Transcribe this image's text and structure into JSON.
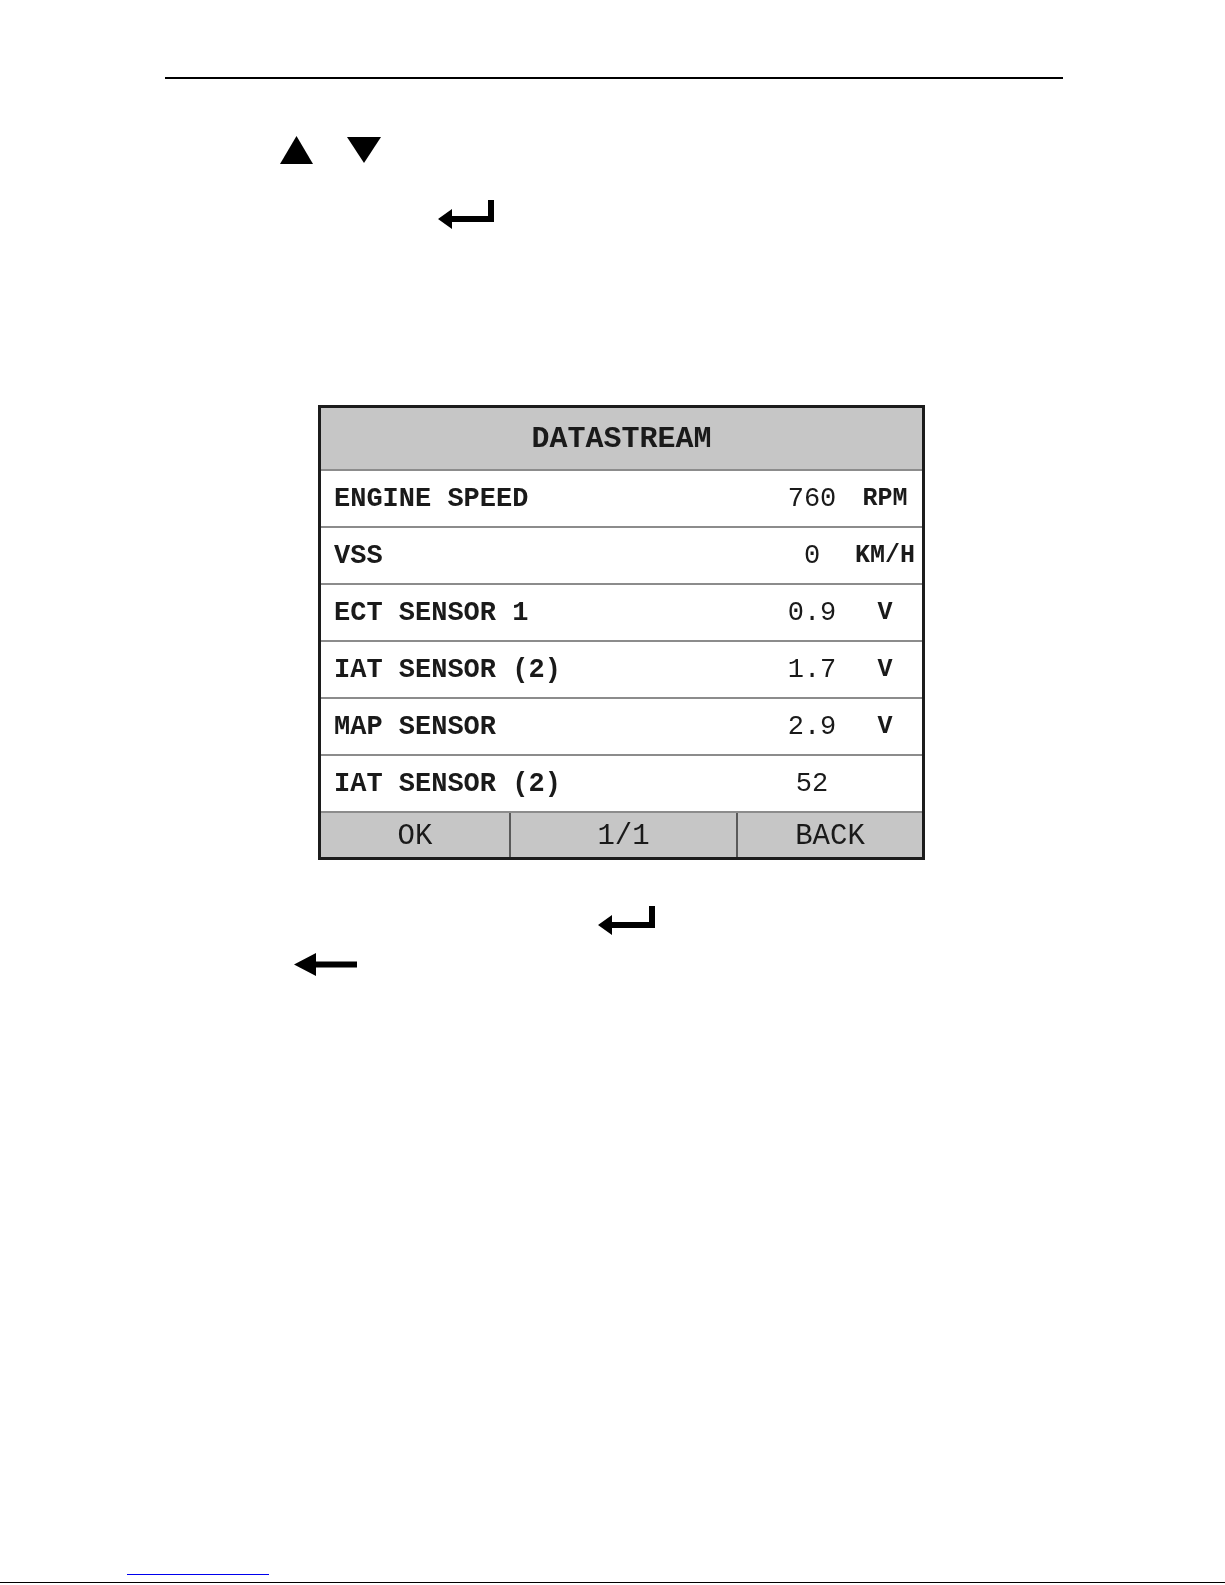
{
  "screen": {
    "title": "DATASTREAM",
    "rows": [
      {
        "label": "ENGINE SPEED",
        "value": "760",
        "unit": "RPM"
      },
      {
        "label": "VSS",
        "value": "0",
        "unit": "KM/H"
      },
      {
        "label": "ECT SENSOR 1",
        "value": "0.9",
        "unit": "V"
      },
      {
        "label": "IAT SENSOR (2)",
        "value": "1.7",
        "unit": "V"
      },
      {
        "label": "MAP SENSOR",
        "value": "2.9",
        "unit": "V"
      },
      {
        "label": "IAT SENSOR (2)",
        "value": "52"
      }
    ],
    "footer": {
      "left_key": "OK",
      "page_indicator": "1/1",
      "right_key": "BACK"
    }
  }
}
